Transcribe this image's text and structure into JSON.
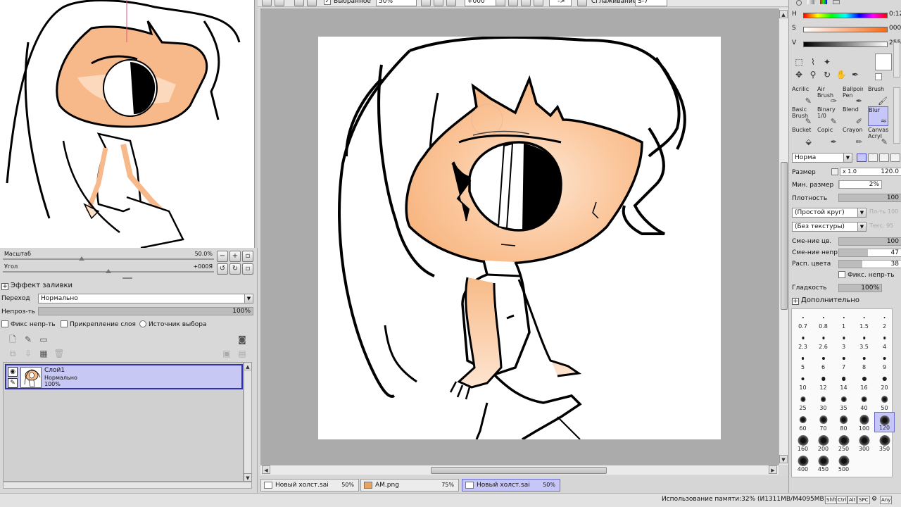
{
  "toolbar": {
    "selected_label": "Выбранное",
    "zoom": "50%",
    "angle": "+000°",
    "arrow": "->",
    "smoothing_label": "Сглаживание",
    "smoothing_value": "S-7"
  },
  "navigator": {
    "zoom_label": "Масштаб",
    "zoom_value": "50.0%",
    "angle_label": "Угол",
    "angle_value": "+000Я"
  },
  "fill_effect": {
    "title": "Эффект заливки",
    "transition_label": "Переход",
    "transition_value": "Нормально",
    "opacity_label": "Непроз-ть",
    "opacity_value": "100%",
    "opacity_fraction": 1.0,
    "fix_opacity": "Фикс непр-ть",
    "clip_layer": "Прикрепление слоя",
    "selection_source": "Источник выбора"
  },
  "layers": [
    {
      "name": "Слой1",
      "mode": "Нормально",
      "opacity": "100%"
    }
  ],
  "tabs": [
    {
      "name": "Новый холст.sai",
      "zoom": "50%",
      "active": false
    },
    {
      "name": "AM.png",
      "zoom": "75%",
      "active": false
    },
    {
      "name": "Новый холст.sai",
      "zoom": "50%",
      "active": true
    }
  ],
  "status": {
    "memory": "Использование памяти:32% (И1311МВ/М4095МВ)",
    "keys": [
      "Shft",
      "Ctrl",
      "Alt",
      "SPC",
      "Any"
    ]
  },
  "color": {
    "h_label": "H",
    "h_value": "0:12",
    "s_label": "S",
    "s_value": "000",
    "v_label": "V",
    "v_value": "255",
    "current": "#ffffff"
  },
  "brushes": [
    {
      "label": "Acrilic",
      "active": false
    },
    {
      "label": "Air Brush",
      "active": false
    },
    {
      "label": "Ballpoint Pen",
      "active": false
    },
    {
      "label": "Brush",
      "active": false
    },
    {
      "label": "Basic Brush",
      "active": false
    },
    {
      "label": "Binary 1/0",
      "active": false
    },
    {
      "label": "Blend",
      "active": false
    },
    {
      "label": "Blur",
      "active": true
    },
    {
      "label": "Bucket",
      "active": false
    },
    {
      "label": "Copic",
      "active": false
    },
    {
      "label": "Crayon",
      "active": false
    },
    {
      "label": "Canvas Acryl",
      "active": false
    }
  ],
  "brush_settings": {
    "mode": "Норма",
    "size_label": "Размер",
    "size_mult": "x 1.0",
    "size_value": "120.0",
    "min_size_label": "Мин. размер",
    "min_size_value": "2%",
    "min_size_fraction": 0.02,
    "density_label": "Плотность",
    "density_value": "100",
    "density_fraction": 1.0,
    "shape": "(Простой круг)",
    "shape_value": "Пл-ть 100",
    "texture": "(Без текстуры)",
    "texture_value": "Текс. 95",
    "color_mix_label": "Сме-ние цв.",
    "color_mix_value": "100",
    "color_mix_fraction": 1.0,
    "opacity_mix_label": "Сме-ние непр.",
    "opacity_mix_value": "47",
    "opacity_mix_fraction": 0.47,
    "color_spread_label": "Расп. цвета",
    "color_spread_value": "38",
    "color_spread_fraction": 0.38,
    "fix_opacity_label": "Фикс. непр-ть",
    "smoothness_label": "Гладкость",
    "smoothness_value": "100%",
    "smoothness_fraction": 1.0,
    "extra_label": "Дополнительно"
  },
  "brush_sizes": [
    "0.7",
    "0.8",
    "1",
    "1.5",
    "2",
    "2.3",
    "2.6",
    "3",
    "3.5",
    "4",
    "5",
    "6",
    "7",
    "8",
    "9",
    "10",
    "12",
    "14",
    "16",
    "20",
    "25",
    "30",
    "35",
    "40",
    "50",
    "60",
    "70",
    "80",
    "100",
    "120",
    "160",
    "200",
    "250",
    "300",
    "350",
    "400",
    "450",
    "500"
  ],
  "selected_size": "120"
}
